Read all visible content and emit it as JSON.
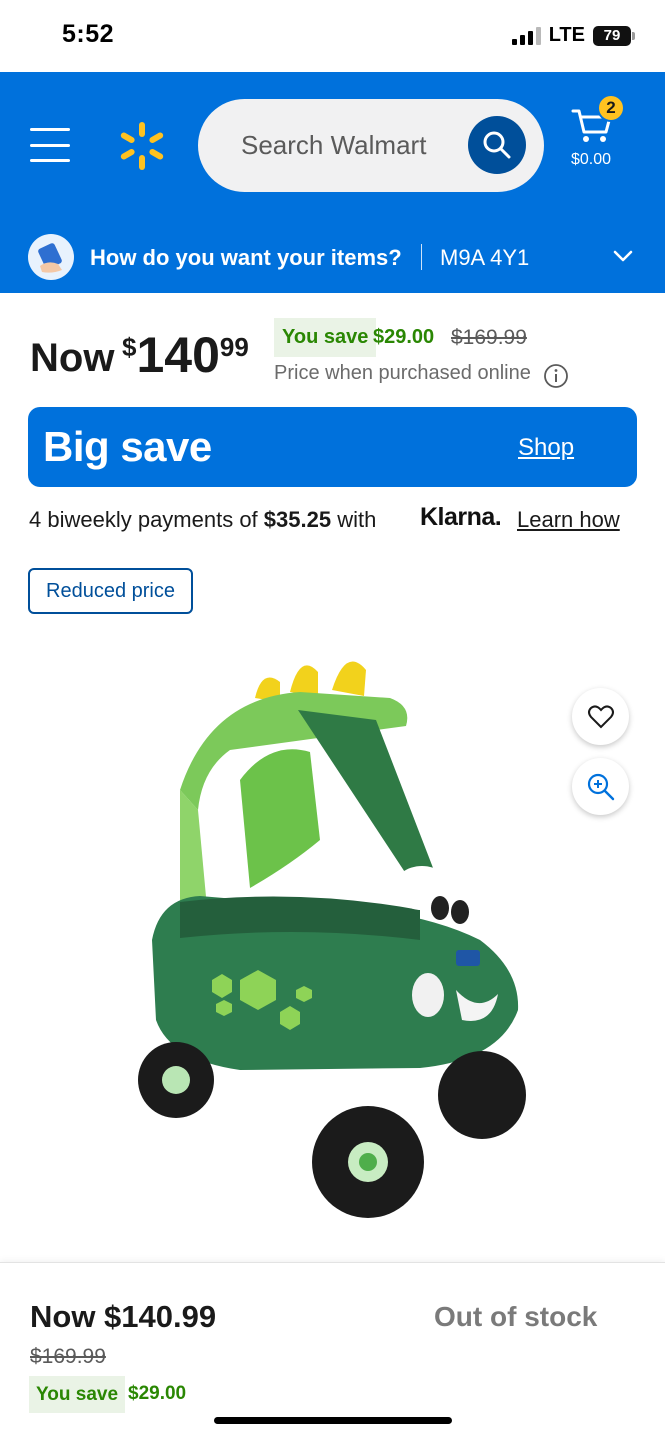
{
  "status_bar": {
    "time": "5:52",
    "network": "LTE",
    "battery": "79"
  },
  "header": {
    "menu_icon": "hamburger-icon",
    "logo_icon": "walmart-spark-icon",
    "search_placeholder": "Search Walmart",
    "search_icon": "search-icon",
    "cart_icon": "cart-icon",
    "cart_count": "2",
    "cart_total": "$0.00",
    "brand_color": "#0071dc",
    "spark_color": "#ffc220"
  },
  "delivery": {
    "question": "How do you want your items?",
    "postal_code": "M9A 4Y1",
    "icon": "delivery-icon",
    "chevron_icon": "chevron-down-icon"
  },
  "price": {
    "now_label": "Now",
    "dollar_sign": "$",
    "amount_whole": "140",
    "amount_cents": "99",
    "you_save_label": "You save",
    "save_amount": "$29.00",
    "was_price": "$169.99",
    "online_note": "Price when purchased online",
    "info_icon": "info-icon",
    "save_color": "#2a8703"
  },
  "big_save": {
    "title": "Big save",
    "shop_link": "Shop"
  },
  "klarna": {
    "text_prefix": "4 biweekly payments of",
    "amount": "$35.25",
    "text_with": "with",
    "brand": "Klarna.",
    "learn_link": "Learn how"
  },
  "badge": {
    "label": "Reduced price"
  },
  "product": {
    "image_alt": "ride-on-car-image",
    "favorite_icon": "heart-icon",
    "zoom_icon": "zoom-in-icon"
  },
  "bottom_bar": {
    "now_price": "Now $140.99",
    "was_price": "$169.99",
    "you_save_label": "You save",
    "save_amount": "$29.00",
    "availability": "Out of stock"
  }
}
